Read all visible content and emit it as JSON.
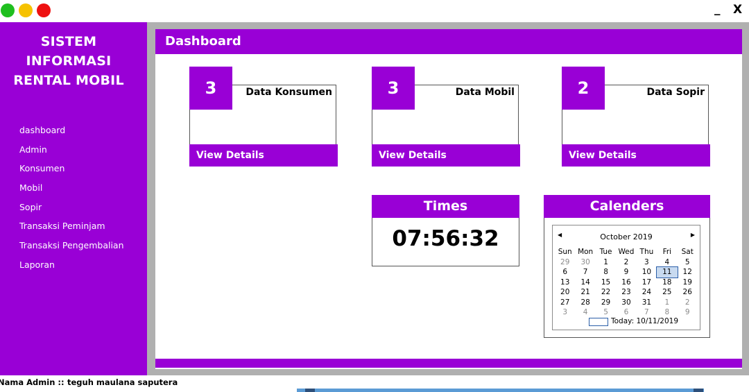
{
  "window": {
    "traffic_lights": [
      "#1fbf1f",
      "#f6c200",
      "#ee1111"
    ],
    "minimize_label": "_",
    "close_label": "X"
  },
  "sidebar": {
    "title_line1": "SISTEM INFORMASI",
    "title_line2": "RENTAL MOBIL",
    "items": [
      {
        "label": "dashboard"
      },
      {
        "label": "Admin"
      },
      {
        "label": "Konsumen"
      },
      {
        "label": "Mobil"
      },
      {
        "label": "Sopir"
      },
      {
        "label": "Transaksi Peminjam"
      },
      {
        "label": "Transaksi Pengembalian"
      },
      {
        "label": "Laporan"
      }
    ]
  },
  "header": {
    "title": "Dashboard"
  },
  "cards": [
    {
      "count": "3",
      "title": "Data Konsumen",
      "link": "View Details"
    },
    {
      "count": "3",
      "title": "Data Mobil",
      "link": "View Details"
    },
    {
      "count": "2",
      "title": "Data Sopir",
      "link": "View Details"
    }
  ],
  "times": {
    "title": "Times",
    "value": "07:56:32"
  },
  "calendar": {
    "title": "Calenders",
    "month": "October 2019",
    "days_of_week": [
      "Sun",
      "Mon",
      "Tue",
      "Wed",
      "Thu",
      "Fri",
      "Sat"
    ],
    "weeks": [
      [
        "29",
        "30",
        "1",
        "2",
        "3",
        "4",
        "5"
      ],
      [
        "6",
        "7",
        "8",
        "9",
        "10",
        "11",
        "12"
      ],
      [
        "13",
        "14",
        "15",
        "16",
        "17",
        "18",
        "19"
      ],
      [
        "20",
        "21",
        "22",
        "23",
        "24",
        "25",
        "26"
      ],
      [
        "27",
        "28",
        "29",
        "30",
        "31",
        "1",
        "2"
      ],
      [
        "3",
        "4",
        "5",
        "6",
        "7",
        "8",
        "9"
      ]
    ],
    "selected_day": "11",
    "today_label": "Today: 10/11/2019"
  },
  "status": {
    "label": "Nama Admin ::",
    "user": "teguh maulana saputera"
  },
  "colors": {
    "accent": "#9900d6",
    "frame": "#b0b0b0",
    "selection": "#c8daf0"
  }
}
